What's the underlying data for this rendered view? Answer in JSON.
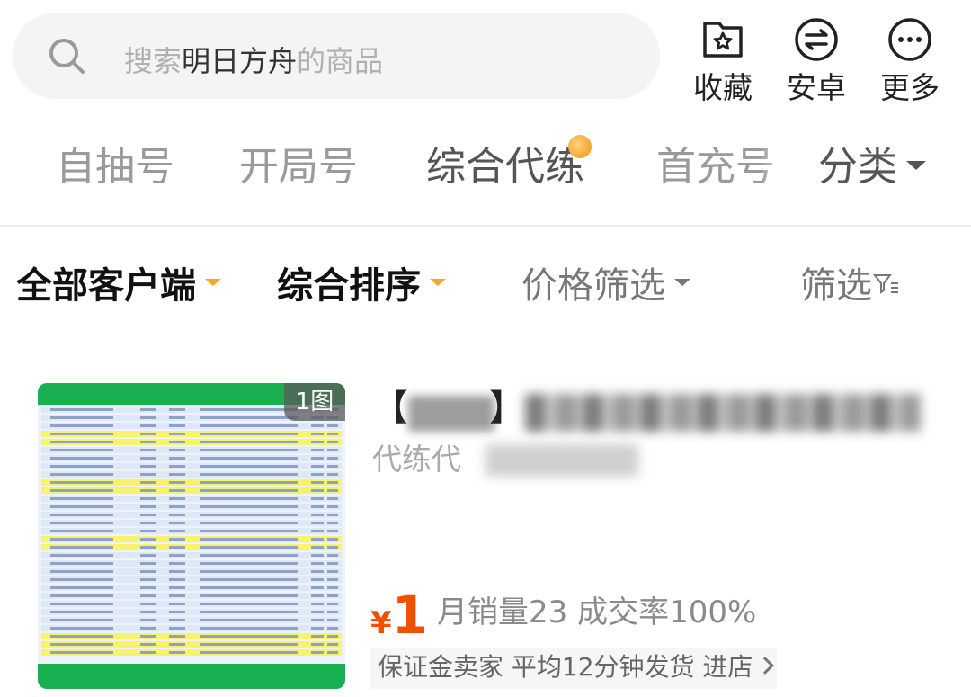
{
  "search": {
    "prefix": "搜索",
    "game": "明日方舟",
    "suffix": "的商品"
  },
  "top_actions": [
    {
      "label": "收藏",
      "icon": "favorite-folder-icon"
    },
    {
      "label": "安卓",
      "icon": "android-platform-icon"
    },
    {
      "label": "更多",
      "icon": "more-icon"
    }
  ],
  "tabs": [
    {
      "label": "自抽号",
      "active": false
    },
    {
      "label": "开局号",
      "active": false
    },
    {
      "label": "综合代练",
      "active": true,
      "hot": true
    },
    {
      "label": "首充号",
      "active": false
    }
  ],
  "category": {
    "label": "分类"
  },
  "filters": {
    "client": "全部客户端",
    "sort": "综合排序",
    "price": "价格筛选",
    "more": "筛选"
  },
  "product": {
    "image_count": "1图",
    "title_open": "【",
    "title_close": "】",
    "subtitle": "代练代",
    "currency": "¥",
    "price": "1",
    "sales": "月销量23  成交率100%",
    "shop_line": "保证金卖家 平均12分钟发货 进店"
  },
  "colors": {
    "accent": "#f05000",
    "sort_caret": "#f5a623",
    "thumb_header": "#18b050"
  }
}
